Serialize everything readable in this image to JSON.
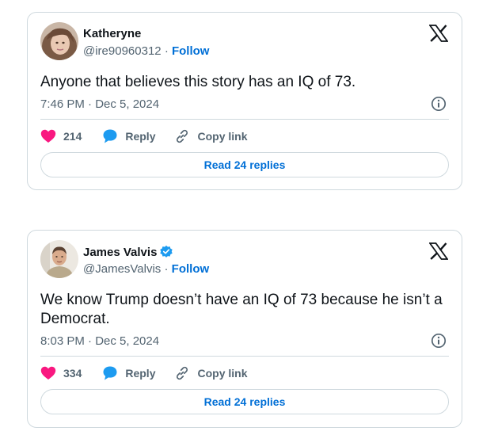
{
  "colors": {
    "like_heart": "#f91880",
    "reply_bubble": "#1d9bf0",
    "link_blue": "#006fd6",
    "muted_text": "#536471",
    "border": "#cfd9de"
  },
  "tweets": [
    {
      "author": {
        "name": "Katheryne",
        "handle": "@ire90960312",
        "separator": "·",
        "follow_label": "Follow",
        "verified": false
      },
      "text": "Anyone that believes this story has an IQ of 73.",
      "timestamp": "7:46 PM · Dec 5, 2024",
      "likes": "214",
      "reply_label": "Reply",
      "copy_label": "Copy link",
      "replies_button": "Read 24 replies"
    },
    {
      "author": {
        "name": "James Valvis",
        "handle": "@JamesValvis",
        "separator": "·",
        "follow_label": "Follow",
        "verified": true
      },
      "text": "We know Trump doesn’t have an IQ of 73 because he isn’t a Democrat.",
      "timestamp": "8:03 PM · Dec 5, 2024",
      "likes": "334",
      "reply_label": "Reply",
      "copy_label": "Copy link",
      "replies_button": "Read 24 replies"
    }
  ],
  "icons": {
    "logo": "x-logo-icon",
    "info": "info-icon",
    "like": "heart-icon",
    "reply": "speech-bubble-icon",
    "copy": "link-icon",
    "verified": "verified-badge-icon"
  }
}
